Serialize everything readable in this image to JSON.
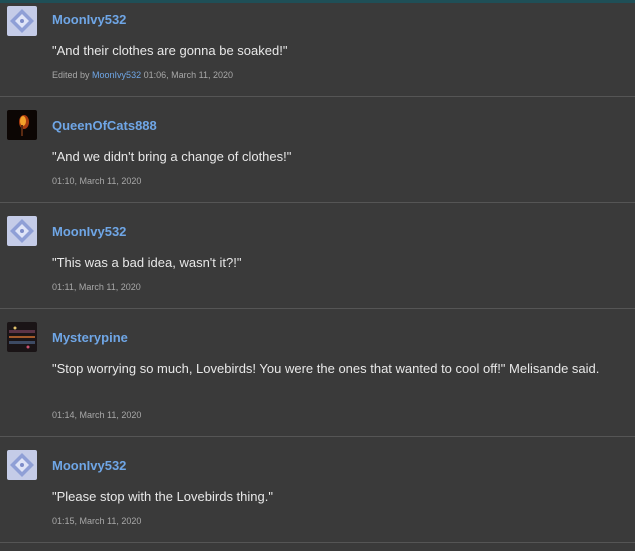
{
  "posts": [
    {
      "author": "MoonIvy532",
      "avatar": "moonivy-avatar",
      "message": "\"And their clothes are gonna be soaked!\"",
      "edited_prefix": "Edited by",
      "edited_by": "MoonIvy532",
      "timestamp": "01:06, March 11, 2020"
    },
    {
      "author": "QueenOfCats888",
      "avatar": "queenofcats-avatar",
      "message": "\"And we didn't bring a change of clothes!\"",
      "timestamp": "01:10, March 11, 2020"
    },
    {
      "author": "MoonIvy532",
      "avatar": "moonivy-avatar",
      "message": "\"This was a bad idea, wasn't it?!\"",
      "timestamp": "01:11, March 11, 2020"
    },
    {
      "author": "Mysterypine",
      "avatar": "mysterypine-avatar",
      "message": "\"Stop worrying so much, Lovebirds! You were the ones that wanted to cool off!\" Melisande said.",
      "timestamp": "01:14, March 11, 2020"
    },
    {
      "author": "MoonIvy532",
      "avatar": "moonivy-avatar",
      "message": "\"Please stop with the Lovebirds thing.\"",
      "timestamp": "01:15, March 11, 2020"
    }
  ],
  "colors": {
    "background": "#3a3a3a",
    "username": "#6fa6e6",
    "message_text": "#e8e8e8",
    "meta_text": "#a8a8a8",
    "divider": "#555555"
  }
}
